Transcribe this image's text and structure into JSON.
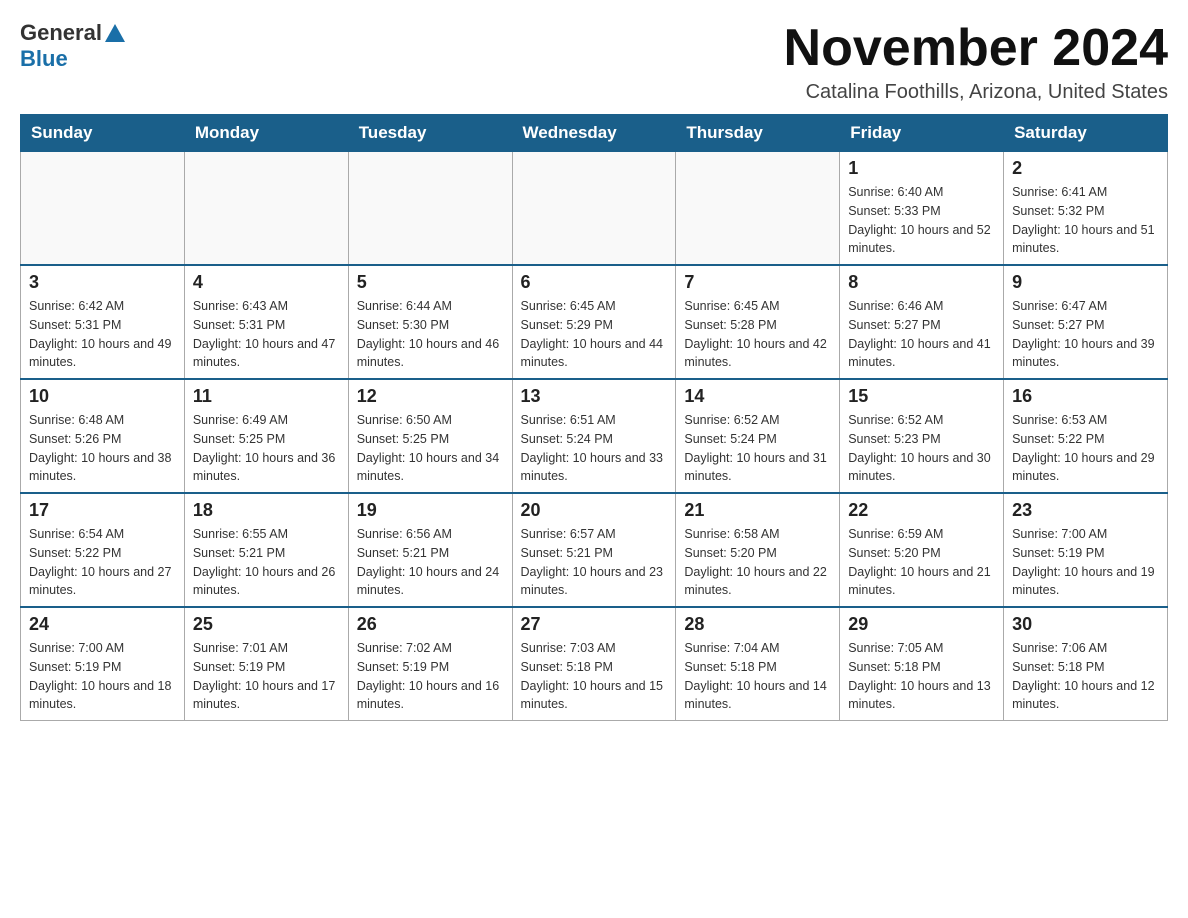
{
  "header": {
    "logo": {
      "general": "General",
      "blue": "Blue"
    },
    "title": "November 2024",
    "location": "Catalina Foothills, Arizona, United States"
  },
  "days_of_week": [
    "Sunday",
    "Monday",
    "Tuesday",
    "Wednesday",
    "Thursday",
    "Friday",
    "Saturday"
  ],
  "weeks": [
    [
      {
        "day": "",
        "empty": true
      },
      {
        "day": "",
        "empty": true
      },
      {
        "day": "",
        "empty": true
      },
      {
        "day": "",
        "empty": true
      },
      {
        "day": "",
        "empty": true
      },
      {
        "day": "1",
        "sunrise": "6:40 AM",
        "sunset": "5:33 PM",
        "daylight": "10 hours and 52 minutes."
      },
      {
        "day": "2",
        "sunrise": "6:41 AM",
        "sunset": "5:32 PM",
        "daylight": "10 hours and 51 minutes."
      }
    ],
    [
      {
        "day": "3",
        "sunrise": "6:42 AM",
        "sunset": "5:31 PM",
        "daylight": "10 hours and 49 minutes."
      },
      {
        "day": "4",
        "sunrise": "6:43 AM",
        "sunset": "5:31 PM",
        "daylight": "10 hours and 47 minutes."
      },
      {
        "day": "5",
        "sunrise": "6:44 AM",
        "sunset": "5:30 PM",
        "daylight": "10 hours and 46 minutes."
      },
      {
        "day": "6",
        "sunrise": "6:45 AM",
        "sunset": "5:29 PM",
        "daylight": "10 hours and 44 minutes."
      },
      {
        "day": "7",
        "sunrise": "6:45 AM",
        "sunset": "5:28 PM",
        "daylight": "10 hours and 42 minutes."
      },
      {
        "day": "8",
        "sunrise": "6:46 AM",
        "sunset": "5:27 PM",
        "daylight": "10 hours and 41 minutes."
      },
      {
        "day": "9",
        "sunrise": "6:47 AM",
        "sunset": "5:27 PM",
        "daylight": "10 hours and 39 minutes."
      }
    ],
    [
      {
        "day": "10",
        "sunrise": "6:48 AM",
        "sunset": "5:26 PM",
        "daylight": "10 hours and 38 minutes."
      },
      {
        "day": "11",
        "sunrise": "6:49 AM",
        "sunset": "5:25 PM",
        "daylight": "10 hours and 36 minutes."
      },
      {
        "day": "12",
        "sunrise": "6:50 AM",
        "sunset": "5:25 PM",
        "daylight": "10 hours and 34 minutes."
      },
      {
        "day": "13",
        "sunrise": "6:51 AM",
        "sunset": "5:24 PM",
        "daylight": "10 hours and 33 minutes."
      },
      {
        "day": "14",
        "sunrise": "6:52 AM",
        "sunset": "5:24 PM",
        "daylight": "10 hours and 31 minutes."
      },
      {
        "day": "15",
        "sunrise": "6:52 AM",
        "sunset": "5:23 PM",
        "daylight": "10 hours and 30 minutes."
      },
      {
        "day": "16",
        "sunrise": "6:53 AM",
        "sunset": "5:22 PM",
        "daylight": "10 hours and 29 minutes."
      }
    ],
    [
      {
        "day": "17",
        "sunrise": "6:54 AM",
        "sunset": "5:22 PM",
        "daylight": "10 hours and 27 minutes."
      },
      {
        "day": "18",
        "sunrise": "6:55 AM",
        "sunset": "5:21 PM",
        "daylight": "10 hours and 26 minutes."
      },
      {
        "day": "19",
        "sunrise": "6:56 AM",
        "sunset": "5:21 PM",
        "daylight": "10 hours and 24 minutes."
      },
      {
        "day": "20",
        "sunrise": "6:57 AM",
        "sunset": "5:21 PM",
        "daylight": "10 hours and 23 minutes."
      },
      {
        "day": "21",
        "sunrise": "6:58 AM",
        "sunset": "5:20 PM",
        "daylight": "10 hours and 22 minutes."
      },
      {
        "day": "22",
        "sunrise": "6:59 AM",
        "sunset": "5:20 PM",
        "daylight": "10 hours and 21 minutes."
      },
      {
        "day": "23",
        "sunrise": "7:00 AM",
        "sunset": "5:19 PM",
        "daylight": "10 hours and 19 minutes."
      }
    ],
    [
      {
        "day": "24",
        "sunrise": "7:00 AM",
        "sunset": "5:19 PM",
        "daylight": "10 hours and 18 minutes."
      },
      {
        "day": "25",
        "sunrise": "7:01 AM",
        "sunset": "5:19 PM",
        "daylight": "10 hours and 17 minutes."
      },
      {
        "day": "26",
        "sunrise": "7:02 AM",
        "sunset": "5:19 PM",
        "daylight": "10 hours and 16 minutes."
      },
      {
        "day": "27",
        "sunrise": "7:03 AM",
        "sunset": "5:18 PM",
        "daylight": "10 hours and 15 minutes."
      },
      {
        "day": "28",
        "sunrise": "7:04 AM",
        "sunset": "5:18 PM",
        "daylight": "10 hours and 14 minutes."
      },
      {
        "day": "29",
        "sunrise": "7:05 AM",
        "sunset": "5:18 PM",
        "daylight": "10 hours and 13 minutes."
      },
      {
        "day": "30",
        "sunrise": "7:06 AM",
        "sunset": "5:18 PM",
        "daylight": "10 hours and 12 minutes."
      }
    ]
  ]
}
